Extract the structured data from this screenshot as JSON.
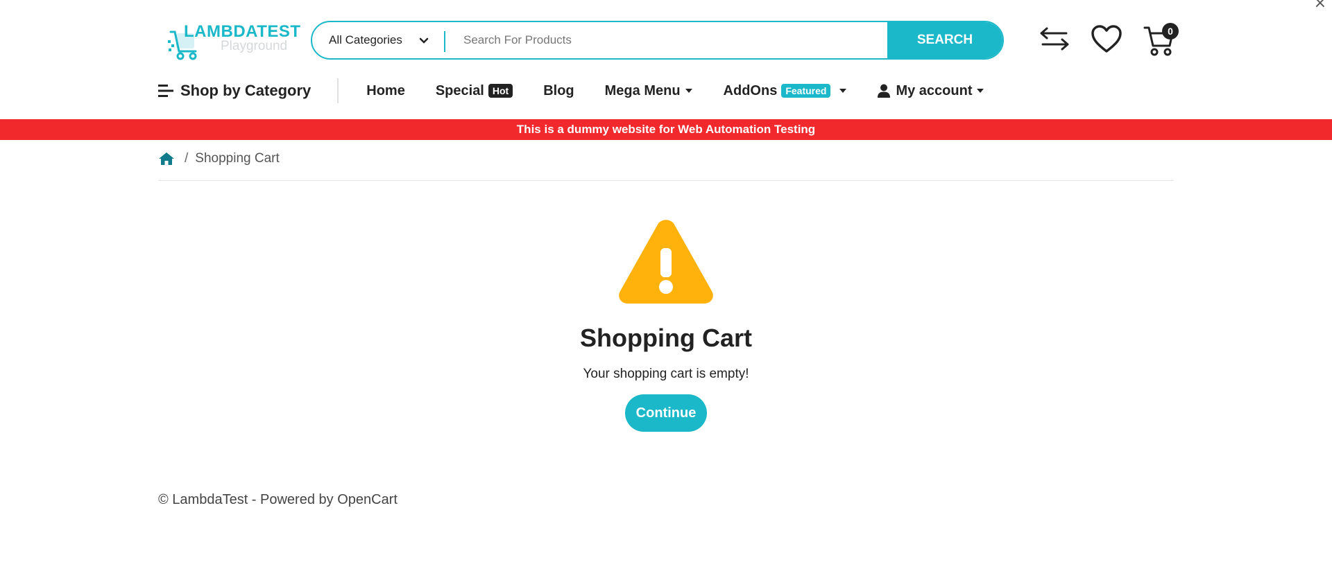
{
  "window": {
    "close_glyph": "×"
  },
  "header": {
    "logo": {
      "brand": "LAMBDATEST",
      "sub": "Playground"
    },
    "search": {
      "category": "All Categories",
      "placeholder": "Search For Products",
      "button_label": "SEARCH"
    },
    "icons": {
      "compare": "compare-arrows-icon",
      "wishlist": "heart-icon",
      "cart": "cart-icon"
    },
    "cart_count": "0"
  },
  "nav": {
    "shop_by_category": "Shop by Category",
    "items": [
      {
        "label": "Home"
      },
      {
        "label": "Special",
        "badge": "Hot"
      },
      {
        "label": "Blog"
      },
      {
        "label": "Mega Menu"
      },
      {
        "label": "AddOns",
        "badge": "Featured"
      },
      {
        "label": "My account"
      }
    ]
  },
  "banner": {
    "text": "This is a dummy website for Web Automation Testing"
  },
  "breadcrumb": {
    "separator": "/",
    "current": "Shopping Cart"
  },
  "cart": {
    "title": "Shopping Cart",
    "message": "Your shopping cart is empty!",
    "continue_label": "Continue"
  },
  "footer": {
    "text": "© LambdaTest - Powered by OpenCart"
  },
  "colors": {
    "accent": "#1ab8c9",
    "banner": "#f1282c",
    "warning": "#ffb20b",
    "dark": "#222222"
  }
}
